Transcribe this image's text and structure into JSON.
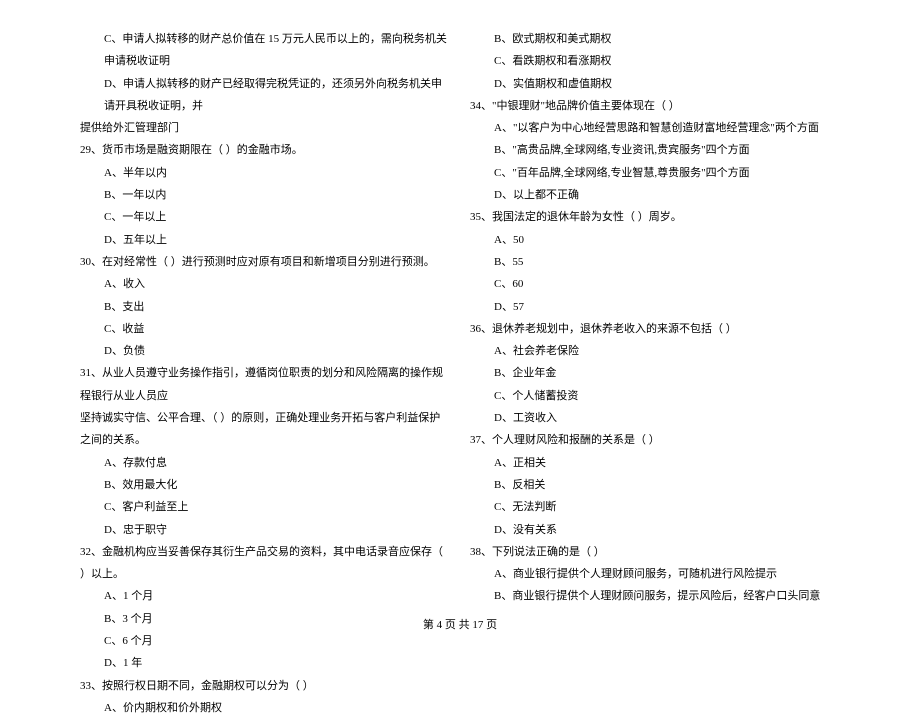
{
  "left": [
    {
      "cls": "indent1",
      "text": "C、申请人拟转移的财产总价值在 15 万元人民币以上的，需向税务机关申请税收证明"
    },
    {
      "cls": "indent1",
      "text": "D、申请人拟转移的财产已经取得完税凭证的，还须另外向税务机关申请开具税收证明，并"
    },
    {
      "cls": "",
      "text": "提供给外汇管理部门"
    },
    {
      "cls": "",
      "text": "29、货币市场是融资期限在（     ）的金融市场。"
    },
    {
      "cls": "indent1",
      "text": "A、半年以内"
    },
    {
      "cls": "indent1",
      "text": "B、一年以内"
    },
    {
      "cls": "indent1",
      "text": "C、一年以上"
    },
    {
      "cls": "indent1",
      "text": "D、五年以上"
    },
    {
      "cls": "",
      "text": "30、在对经常性（     ）进行预测时应对原有项目和新增项目分别进行预测。"
    },
    {
      "cls": "indent1",
      "text": "A、收入"
    },
    {
      "cls": "indent1",
      "text": "B、支出"
    },
    {
      "cls": "indent1",
      "text": "C、收益"
    },
    {
      "cls": "indent1",
      "text": "D、负债"
    },
    {
      "cls": "",
      "text": "31、从业人员遵守业务操作指引，遵循岗位职责的划分和风险隔离的操作规程银行从业人员应"
    },
    {
      "cls": "",
      "text": "坚持诚实守信、公平合理、（     ）的原则，正确处理业务开拓与客户利益保护之间的关系。"
    },
    {
      "cls": "indent1",
      "text": "A、存款付息"
    },
    {
      "cls": "indent1",
      "text": "B、效用最大化"
    },
    {
      "cls": "indent1",
      "text": "C、客户利益至上"
    },
    {
      "cls": "indent1",
      "text": "D、忠于职守"
    },
    {
      "cls": "",
      "text": "32、金融机构应当妥善保存其衍生产品交易的资料，其中电话录音应保存（     ）以上。"
    },
    {
      "cls": "indent1",
      "text": "A、1 个月"
    },
    {
      "cls": "indent1",
      "text": "B、3 个月"
    },
    {
      "cls": "indent1",
      "text": "C、6 个月"
    },
    {
      "cls": "indent1",
      "text": "D、1 年"
    },
    {
      "cls": "",
      "text": "33、按照行权日期不同，金融期权可以分为（     ）"
    },
    {
      "cls": "indent1",
      "text": "A、价内期权和价外期权"
    }
  ],
  "right": [
    {
      "cls": "indent1",
      "text": "B、欧式期权和美式期权"
    },
    {
      "cls": "indent1",
      "text": "C、看跌期权和看涨期权"
    },
    {
      "cls": "indent1",
      "text": "D、实值期权和虚值期权"
    },
    {
      "cls": "",
      "text": "34、\"中银理财\"地品牌价值主要体现在（     ）"
    },
    {
      "cls": "indent1",
      "text": "A、\"以客户为中心地经营思路和智慧创造财富地经营理念\"两个方面"
    },
    {
      "cls": "indent1",
      "text": "B、\"高贵品牌,全球网络,专业资讯,贵宾服务\"四个方面"
    },
    {
      "cls": "indent1",
      "text": "C、\"百年品牌,全球网络,专业智慧,尊贵服务\"四个方面"
    },
    {
      "cls": "indent1",
      "text": "D、以上都不正确"
    },
    {
      "cls": "",
      "text": "35、我国法定的退休年龄为女性（     ）周岁。"
    },
    {
      "cls": "indent1",
      "text": "A、50"
    },
    {
      "cls": "indent1",
      "text": "B、55"
    },
    {
      "cls": "indent1",
      "text": "C、60"
    },
    {
      "cls": "indent1",
      "text": "D、57"
    },
    {
      "cls": "",
      "text": "36、退休养老规划中，退休养老收入的来源不包括（     ）"
    },
    {
      "cls": "indent1",
      "text": "A、社会养老保险"
    },
    {
      "cls": "indent1",
      "text": "B、企业年金"
    },
    {
      "cls": "indent1",
      "text": "C、个人储蓄投资"
    },
    {
      "cls": "indent1",
      "text": "D、工资收入"
    },
    {
      "cls": "",
      "text": "37、个人理财风险和报酬的关系是（     ）"
    },
    {
      "cls": "indent1",
      "text": "A、正相关"
    },
    {
      "cls": "indent1",
      "text": "B、反相关"
    },
    {
      "cls": "indent1",
      "text": "C、无法判断"
    },
    {
      "cls": "indent1",
      "text": "D、没有关系"
    },
    {
      "cls": "",
      "text": "38、下列说法正确的是（     ）"
    },
    {
      "cls": "indent1",
      "text": "A、商业银行提供个人理财顾问服务，可随机进行风险提示"
    },
    {
      "cls": "indent1",
      "text": "B、商业银行提供个人理财顾问服务，提示风险后，经客户口头同意"
    }
  ],
  "footer": "第 4 页 共 17 页"
}
